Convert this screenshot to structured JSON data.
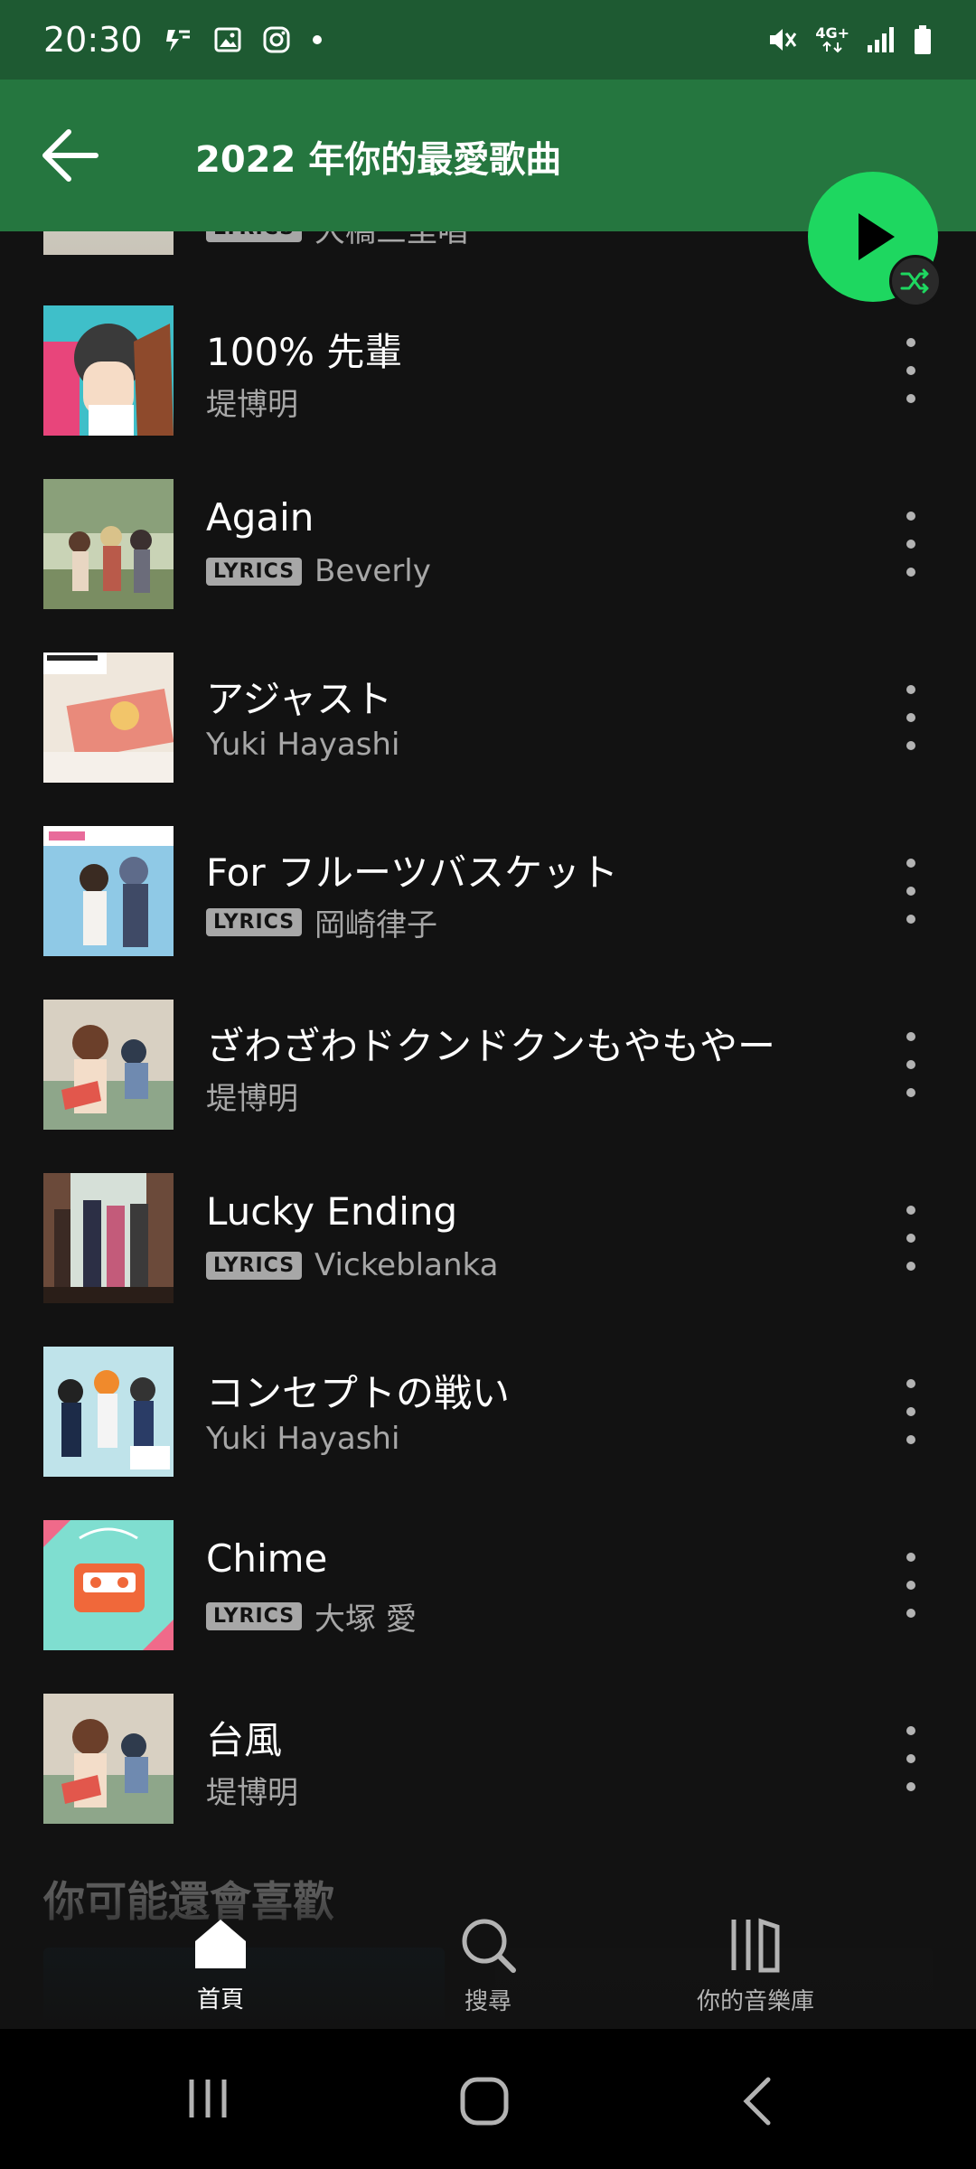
{
  "status_bar": {
    "time": "20:30",
    "left_icons": [
      "data-saver-icon",
      "image-icon",
      "instagram-icon",
      "dot-icon"
    ],
    "right_icons": [
      "mute-icon",
      "4g-icon",
      "signal-icon",
      "battery-icon"
    ],
    "network": "4G+"
  },
  "header": {
    "title": "2022 年你的最愛歌曲",
    "back_icon": "arrow-left-icon"
  },
  "controls": {
    "play_icon": "play-icon",
    "shuffle_icon": "shuffle-icon",
    "accent": "#1ed760"
  },
  "partial_row": {
    "badge": "LYRICS",
    "artist": "大橋三里唱"
  },
  "songs": [
    {
      "title": "100% 先輩",
      "artist": "堤博明",
      "lyrics": ""
    },
    {
      "title": "Again",
      "artist": "Beverly",
      "lyrics": "LYRICS"
    },
    {
      "title": "アジャスト",
      "artist": "Yuki Hayashi",
      "lyrics": ""
    },
    {
      "title": "For フルーツバスケット",
      "artist": "岡崎律子",
      "lyrics": "LYRICS"
    },
    {
      "title": "ざわざわドクンドクンもやもやー",
      "artist": "堤博明",
      "lyrics": ""
    },
    {
      "title": "Lucky Ending",
      "artist": "Vickeblanka",
      "lyrics": "LYRICS"
    },
    {
      "title": "コンセプトの戦い",
      "artist": "Yuki Hayashi",
      "lyrics": ""
    },
    {
      "title": "Chime",
      "artist": "大塚 愛",
      "lyrics": "LYRICS"
    },
    {
      "title": "台風",
      "artist": "堤博明",
      "lyrics": ""
    }
  ],
  "section": {
    "title": "你可能還會喜歡"
  },
  "bottom_nav": {
    "home": "首頁",
    "search": "搜尋",
    "library": "你的音樂庫"
  },
  "system_nav": [
    "recents-icon",
    "home-circle-icon",
    "back-chevron-icon"
  ]
}
